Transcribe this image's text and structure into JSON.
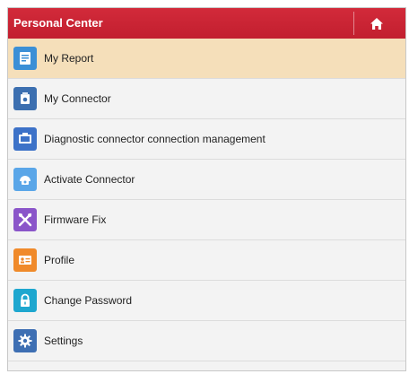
{
  "header": {
    "title": "Personal Center",
    "home_icon": "home-icon"
  },
  "menu": {
    "selected_index": 0,
    "items": [
      {
        "label": "My Report",
        "icon": "report-icon",
        "icon_color": "#3b8fd6"
      },
      {
        "label": "My Connector",
        "icon": "connector-icon",
        "icon_color": "#3c6fb0"
      },
      {
        "label": "Diagnostic connector connection management",
        "icon": "connection-management-icon",
        "icon_color": "#3d72c8"
      },
      {
        "label": "Activate Connector",
        "icon": "activate-connector-icon",
        "icon_color": "#5aa6e8"
      },
      {
        "label": "Firmware Fix",
        "icon": "firmware-fix-icon",
        "icon_color": "#8a55c9"
      },
      {
        "label": "Profile",
        "icon": "profile-icon",
        "icon_color": "#f08a2a"
      },
      {
        "label": "Change Password",
        "icon": "lock-icon",
        "icon_color": "#1ea7cf"
      },
      {
        "label": "Settings",
        "icon": "gear-icon",
        "icon_color": "#3e6fb3"
      }
    ]
  }
}
